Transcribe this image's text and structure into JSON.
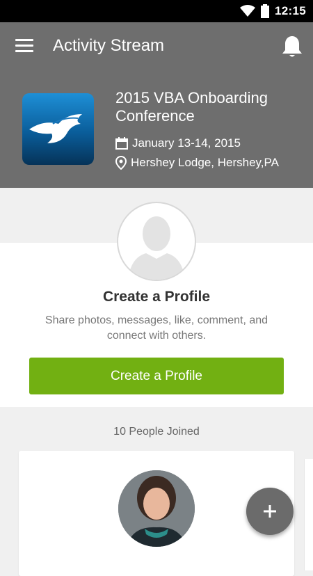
{
  "status_bar": {
    "time": "12:15",
    "icons": [
      "wifi-icon",
      "battery-icon"
    ]
  },
  "app_bar": {
    "title": "Activity Stream",
    "menu_icon": "hamburger-menu-icon",
    "notification_icon": "bell-icon"
  },
  "event": {
    "title": "2015 VBA Onboarding Conference",
    "date": "January 13-14, 2015",
    "location": "Hershey Lodge, Hershey,PA",
    "date_icon": "calendar-icon",
    "location_icon": "location-pin-icon"
  },
  "profile_prompt": {
    "heading": "Create a Profile",
    "description": "Share photos, messages, like, comment, and connect with others.",
    "button_label": "Create a Profile",
    "button_color": "#72b012"
  },
  "people": {
    "joined_label": "10 People Joined"
  },
  "fab": {
    "icon": "plus-icon"
  },
  "colors": {
    "app_bar_bg": "#6e6e6e",
    "page_bg": "#f0f0f0"
  }
}
